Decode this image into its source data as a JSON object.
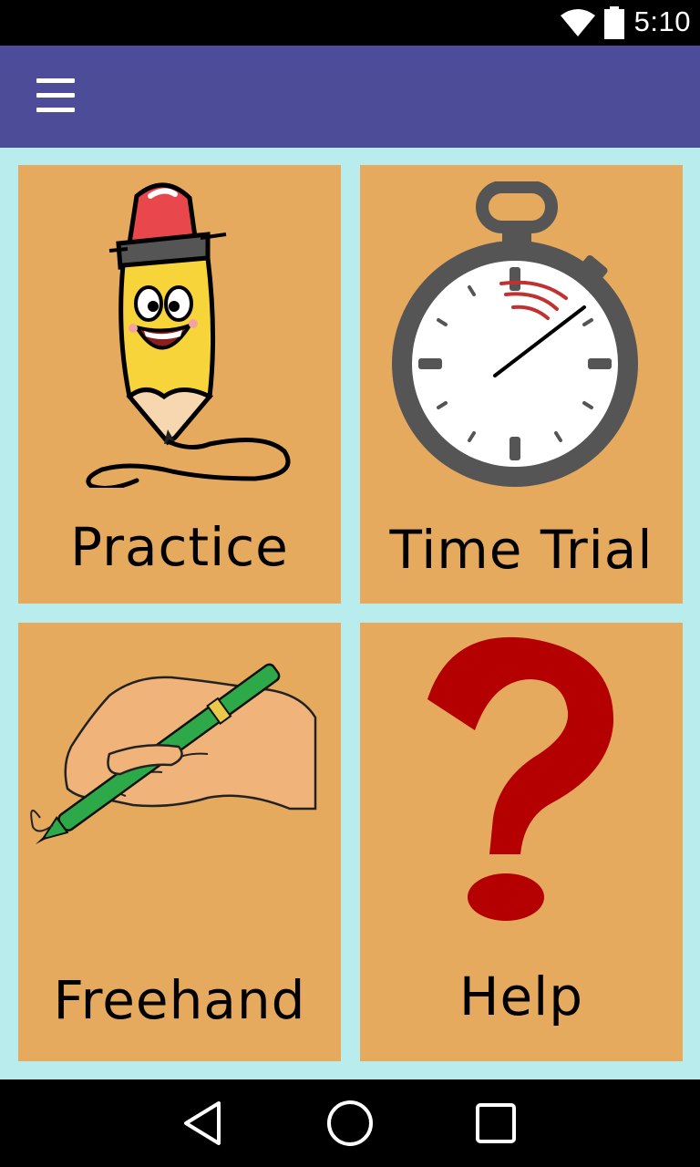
{
  "status_bar": {
    "time": "5:10",
    "icons": [
      "wifi-icon",
      "battery-icon"
    ]
  },
  "app_bar": {
    "menu_icon": "hamburger-menu-icon"
  },
  "tiles": [
    {
      "label": "Practice",
      "icon": "pencil-character-icon"
    },
    {
      "label": "Time Trial",
      "icon": "stopwatch-icon"
    },
    {
      "label": "Freehand",
      "icon": "hand-writing-icon"
    },
    {
      "label": "Help",
      "icon": "question-mark-icon"
    }
  ],
  "nav_bar": {
    "icons": [
      "back-icon",
      "home-icon",
      "recents-icon"
    ]
  },
  "colors": {
    "app_bar": "#4d4c98",
    "background": "#b9ecec",
    "tile": "#e5aa5e",
    "question_mark": "#b40000"
  }
}
